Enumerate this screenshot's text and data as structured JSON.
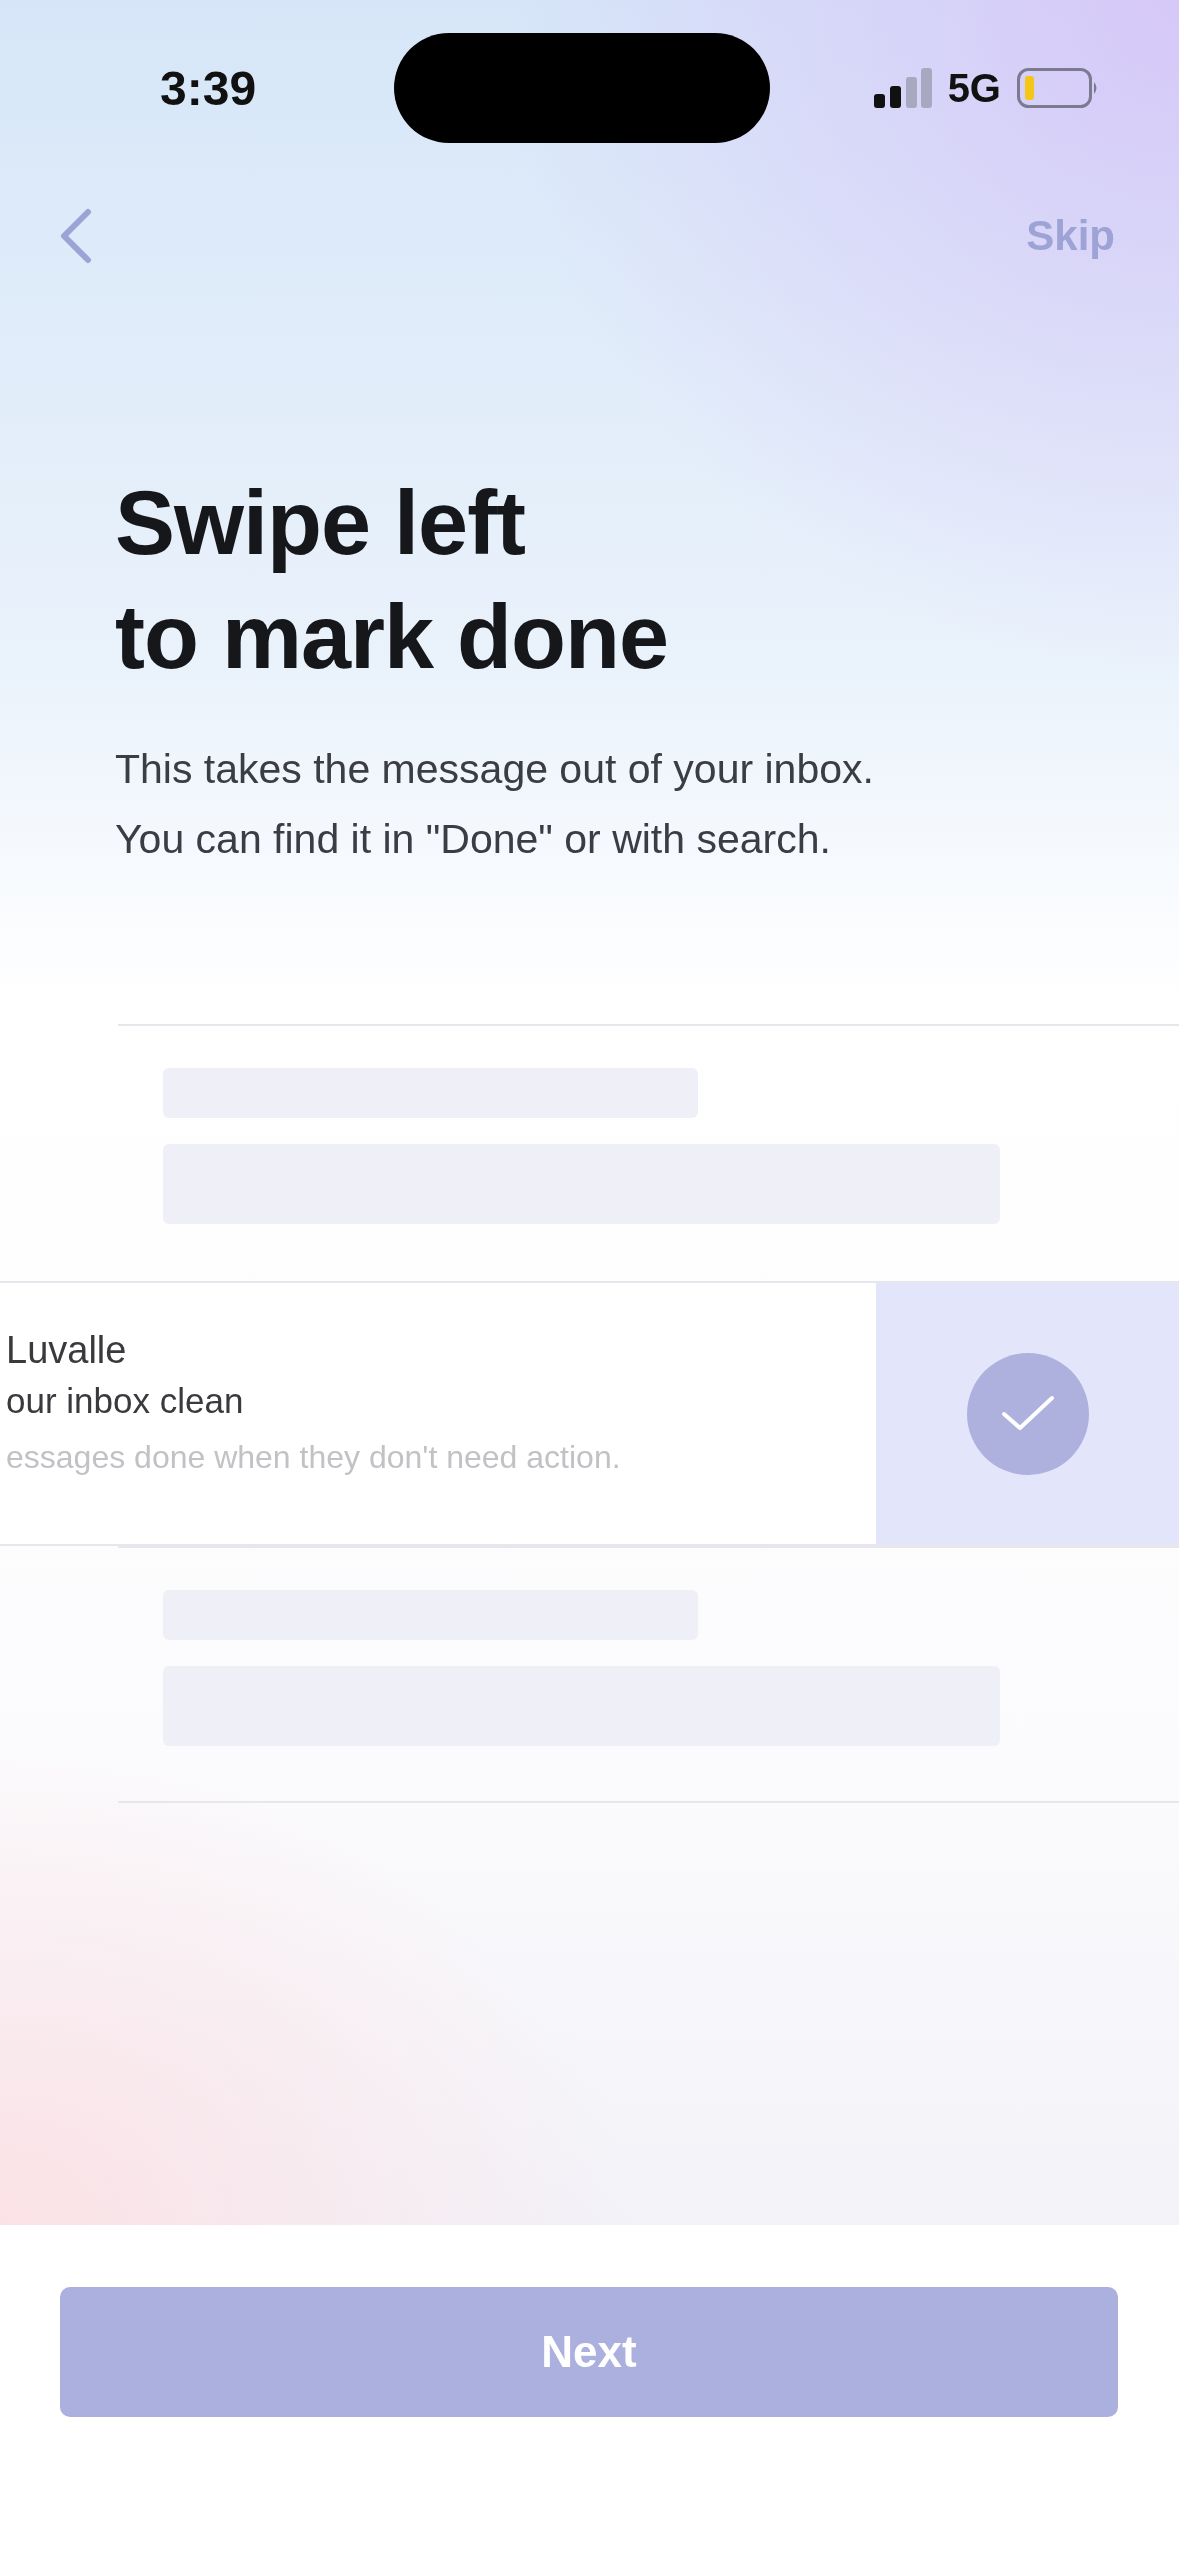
{
  "status_bar": {
    "time": "3:39",
    "network": "5G"
  },
  "nav": {
    "skip": "Skip"
  },
  "title": "Swipe left\nto mark done",
  "subtitle": "This takes the message out of your inbox.\nYou can find it in \"Done\" or with search.",
  "swiped_message": {
    "sender": "Luvalle",
    "subject": "our inbox clean",
    "preview": "essages done when they don't need action."
  },
  "next_button": "Next"
}
